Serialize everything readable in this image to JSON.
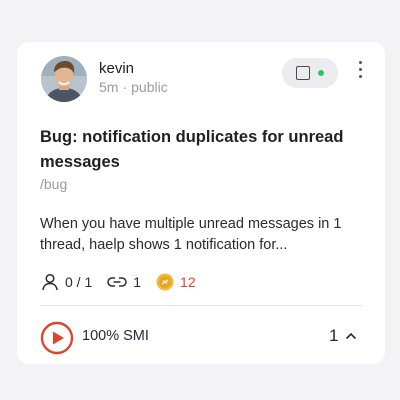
{
  "post": {
    "author": "kevin",
    "time_ago": "5m",
    "meta_separator": "·",
    "visibility": "public",
    "title": "Bug: notification duplicates for unread messages",
    "tag": "/bug",
    "description": "When you have multiple unread messages in 1 thread, haelp shows 1 notification for..."
  },
  "stats": {
    "participants": "0 / 1",
    "links": "1",
    "coins": "12"
  },
  "footer": {
    "smi_label": "100% SMI",
    "vote_count": "1"
  },
  "status_indicator_color": "#2fc26b",
  "accent_color": "#e0452c",
  "icons": [
    "avatar",
    "status-square-icon",
    "online-dot-icon",
    "more-vertical-icon",
    "user-icon",
    "link-icon",
    "coin-icon",
    "play-icon",
    "chevron-up-icon"
  ]
}
